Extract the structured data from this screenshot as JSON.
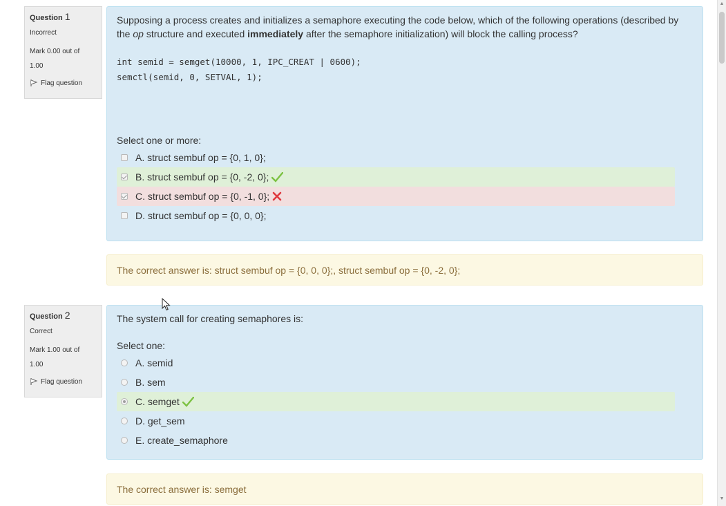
{
  "colors": {
    "formulation_bg": "#d9eaf5",
    "feedback_bg": "#fcf8e3",
    "feedback_text": "#8a6d3b",
    "correct_bg": "#dff0d8",
    "incorrect_bg": "#f2dede",
    "tick": "#7cc242",
    "cross": "#e0383e"
  },
  "questions": [
    {
      "label": "Question",
      "number": "1",
      "state": "Incorrect",
      "grade": "Mark 0.00 out of 1.00",
      "flag": "Flag question",
      "text_pre": "Supposing a process creates and initializes a semaphore executing the code below, which of the following operations (described by the ",
      "text_em": "op",
      "text_mid": " structure and executed ",
      "text_strong": "immediately",
      "text_post": " after the semaphore initialization) will block the calling process?",
      "code_line1": "int semid = semget(10000, 1, IPC_CREAT | 0600);",
      "code_line2": "semctl(semid, 0, SETVAL, 1);",
      "prompt": "Select one or more:",
      "options": [
        {
          "label": "A. struct sembuf op = {0, 1, 0};",
          "checked": false,
          "status": "none"
        },
        {
          "label": "B. struct sembuf op = {0, -2, 0};",
          "checked": true,
          "status": "correct",
          "icon": "check-icon"
        },
        {
          "label": "C. struct sembuf op = {0, -1, 0};",
          "checked": true,
          "status": "incorrect",
          "icon": "cross-icon"
        },
        {
          "label": "D. struct sembuf op = {0, 0, 0};",
          "checked": false,
          "status": "none"
        }
      ],
      "feedback": "The correct answer is: struct sembuf op = {0, 0, 0};, struct sembuf op = {0, -2, 0};"
    },
    {
      "label": "Question",
      "number": "2",
      "state": "Correct",
      "grade": "Mark 1.00 out of 1.00",
      "flag": "Flag question",
      "text": "The system call for creating semaphores is:",
      "prompt": "Select one:",
      "options": [
        {
          "label": "A. semid",
          "checked": false,
          "status": "none"
        },
        {
          "label": "B. sem",
          "checked": false,
          "status": "none"
        },
        {
          "label": "C. semget",
          "checked": true,
          "status": "correct",
          "icon": "check-icon"
        },
        {
          "label": "D. get_sem",
          "checked": false,
          "status": "none"
        },
        {
          "label": "E. create_semaphore",
          "checked": false,
          "status": "none"
        }
      ],
      "feedback": "The correct answer is: semget"
    }
  ]
}
